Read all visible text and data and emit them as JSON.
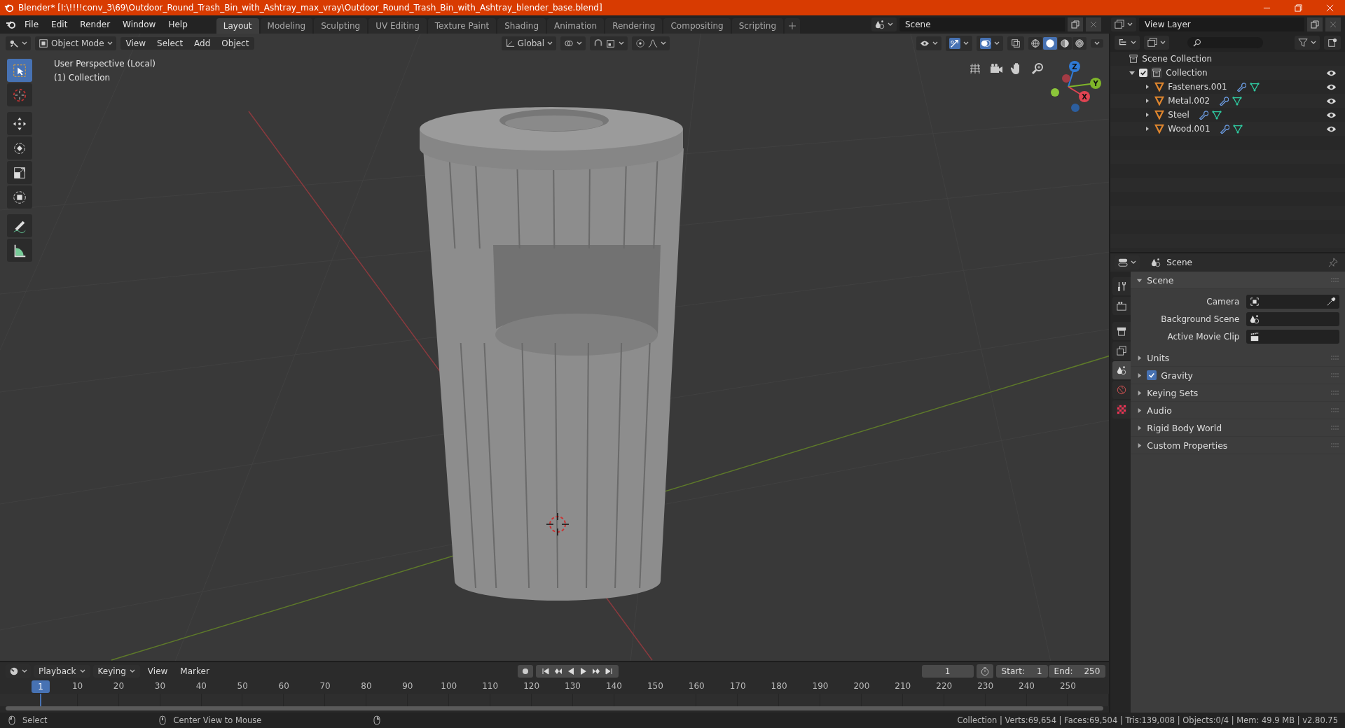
{
  "window": {
    "title": "Blender* [I:\\!!!!conv_3\\69\\Outdoor_Round_Trash_Bin_with_Ashtray_max_vray\\Outdoor_Round_Trash_Bin_with_Ashtray_blender_base.blend]"
  },
  "menu": [
    "File",
    "Edit",
    "Render",
    "Window",
    "Help"
  ],
  "workspaces": [
    {
      "label": "Layout",
      "selected": true
    },
    {
      "label": "Modeling",
      "selected": false
    },
    {
      "label": "Sculpting",
      "selected": false
    },
    {
      "label": "UV Editing",
      "selected": false
    },
    {
      "label": "Texture Paint",
      "selected": false
    },
    {
      "label": "Shading",
      "selected": false
    },
    {
      "label": "Animation",
      "selected": false
    },
    {
      "label": "Rendering",
      "selected": false
    },
    {
      "label": "Compositing",
      "selected": false
    },
    {
      "label": "Scripting",
      "selected": false
    }
  ],
  "scene_field": {
    "value": "Scene"
  },
  "view_layer_field": {
    "value": "View Layer"
  },
  "viewport": {
    "mode": "Object Mode",
    "menus": [
      "View",
      "Select",
      "Add",
      "Object"
    ],
    "orientation": "Global",
    "overlay_text": [
      "User Perspective (Local)",
      "(1) Collection"
    ],
    "tools": [
      {
        "kind": "select",
        "selected": true
      },
      {
        "kind": "cursor",
        "selected": false
      },
      {
        "kind": "move",
        "selected": false
      },
      {
        "kind": "rotate",
        "selected": false
      },
      {
        "kind": "scale",
        "selected": false
      },
      {
        "kind": "transform",
        "selected": false
      },
      {
        "kind": "annotate",
        "selected": false
      },
      {
        "kind": "measure",
        "selected": false
      }
    ],
    "shading": [
      {
        "kind": "wireframe",
        "selected": false
      },
      {
        "kind": "solid",
        "selected": true
      },
      {
        "kind": "material",
        "selected": false
      },
      {
        "kind": "rendered",
        "selected": false
      }
    ],
    "gizmo_axes": [
      {
        "label": "Z",
        "color": "#2f7bd8"
      },
      {
        "label": "Y",
        "color": "#7fb52a"
      },
      {
        "label": "X",
        "color": "#e04452"
      }
    ]
  },
  "outliner": {
    "root": "Scene Collection",
    "items": [
      {
        "label": "Collection",
        "checked": true,
        "expanded": true,
        "children": [
          {
            "label": "Fasteners.001",
            "expanded": false
          },
          {
            "label": "Metal.002",
            "expanded": false
          },
          {
            "label": "Steel",
            "expanded": false
          },
          {
            "label": "Wood.001",
            "expanded": false
          }
        ]
      }
    ]
  },
  "properties": {
    "title": "Scene",
    "panels": [
      {
        "label": "Scene",
        "kind": "plain",
        "expanded": true,
        "fields": [
          {
            "label": "Camera",
            "kind": "camera"
          },
          {
            "label": "Background Scene",
            "kind": "scene"
          },
          {
            "label": "Active Movie Clip",
            "kind": "clip"
          }
        ]
      },
      {
        "label": "Units",
        "kind": "plain",
        "expanded": false
      },
      {
        "label": "Gravity",
        "kind": "toggle",
        "checked": true,
        "expanded": false
      },
      {
        "label": "Keying Sets",
        "kind": "plain",
        "expanded": false
      },
      {
        "label": "Audio",
        "kind": "plain",
        "expanded": false
      },
      {
        "label": "Rigid Body World",
        "kind": "plain",
        "expanded": false
      },
      {
        "label": "Custom Properties",
        "kind": "plain",
        "expanded": false
      }
    ]
  },
  "timeline": {
    "menus": [
      {
        "label": "Playback",
        "dropdown": true
      },
      {
        "label": "Keying",
        "dropdown": true
      },
      {
        "label": "View",
        "dropdown": false
      },
      {
        "label": "Marker",
        "dropdown": false
      }
    ],
    "current_frame": "1",
    "start_label": "Start:",
    "start": "1",
    "end_label": "End:",
    "end": "250",
    "playhead": "1",
    "ticks": [
      "10",
      "20",
      "30",
      "40",
      "50",
      "60",
      "70",
      "80",
      "90",
      "100",
      "110",
      "120",
      "130",
      "140",
      "150",
      "160",
      "170",
      "180",
      "190",
      "200",
      "210",
      "220",
      "230",
      "240",
      "250"
    ]
  },
  "status_bar": {
    "hints": [
      "Select",
      "Center View to Mouse"
    ],
    "stats": "Collection | Verts:69,654 | Faces:69,504 | Tris:139,008 | Objects:0/4 | Mem: 49.9 MB | v2.80.75"
  }
}
